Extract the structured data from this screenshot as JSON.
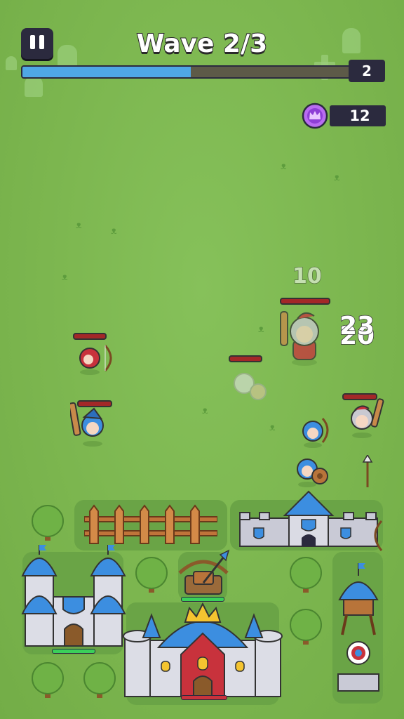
{
  "hud": {
    "wave_label": "Wave 2/3",
    "wave_progress": 0.5,
    "wave_counter": "2",
    "gems": "12"
  },
  "combat": {
    "damage_numbers": [
      "10",
      "23",
      "20"
    ]
  },
  "icons": {
    "pause": "pause-icon",
    "gem": "crown-gem-icon"
  },
  "colors": {
    "grass": "#7cb64f",
    "hud_dark": "#2b2a3e",
    "progress_fill": "#4fa7e6",
    "roof_blue": "#3c8ee0",
    "enemy_red": "#c8323c",
    "gem_purple": "#9b4fe0"
  }
}
